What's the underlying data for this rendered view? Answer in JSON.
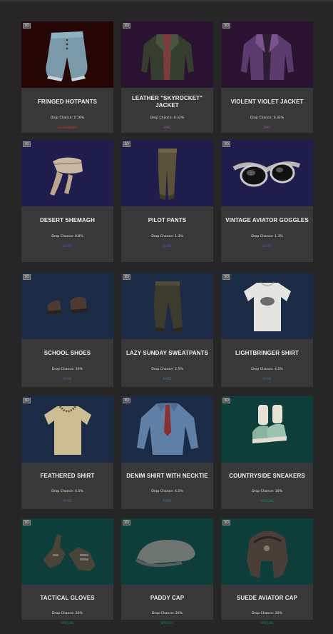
{
  "drop_chance_label": "Drop Chance:",
  "badge": "3D",
  "colors": {
    "legendary": "#c0392b",
    "epic": "#9b59b6",
    "elite": "#5b5bd6",
    "rare": "#4d6f9a",
    "special": "#1f8a6a"
  },
  "items": [
    {
      "name": "FRINGED HOTPANTS",
      "drop": "0.16%",
      "rarity": "LEGENDARY",
      "icon": "hotpants-icon"
    },
    {
      "name": "LEATHER \"SKYROCKET\" JACKET",
      "drop": "0.32%",
      "rarity": "EPIC",
      "icon": "leather-jacket-icon"
    },
    {
      "name": "VIOLENT VIOLET JACKET",
      "drop": "0.32%",
      "rarity": "EPIC",
      "icon": "violet-jacket-icon"
    },
    {
      "name": "DESERT SHEMAGH",
      "drop": "0.8%",
      "rarity": "ELITE",
      "icon": "shemagh-icon"
    },
    {
      "name": "PILOT PANTS",
      "drop": "1.3%",
      "rarity": "ELITE",
      "icon": "pilot-pants-icon"
    },
    {
      "name": "VINTAGE AVIATOR GOGGLES",
      "drop": "1.3%",
      "rarity": "ELITE",
      "icon": "goggles-icon"
    },
    {
      "name": "SCHOOL SHOES",
      "drop": "10%",
      "rarity": "RARE",
      "icon": "shoes-icon"
    },
    {
      "name": "LAZY SUNDAY SWEATPANTS",
      "drop": "2.5%",
      "rarity": "RARE",
      "icon": "sweatpants-icon"
    },
    {
      "name": "LIGHTBRINGER SHIRT",
      "drop": "4.5%",
      "rarity": "RARE",
      "icon": "tshirt-icon"
    },
    {
      "name": "FEATHERED SHIRT",
      "drop": "4.5%",
      "rarity": "RARE",
      "icon": "feathered-shirt-icon"
    },
    {
      "name": "DENIM SHIRT WITH NECKTIE",
      "drop": "4.5%",
      "rarity": "RARE",
      "icon": "denim-shirt-icon"
    },
    {
      "name": "COUNTRYSIDE SNEAKERS",
      "drop": "10%",
      "rarity": "SPECIAL",
      "icon": "sneakers-icon"
    },
    {
      "name": "TACTICAL GLOVES",
      "drop": "20%",
      "rarity": "SPECIAL",
      "icon": "gloves-icon"
    },
    {
      "name": "PADDY CAP",
      "drop": "20%",
      "rarity": "SPECIAL",
      "icon": "paddy-cap-icon"
    },
    {
      "name": "SUEDE AVIATOR CAP",
      "drop": "20%",
      "rarity": "SPECIAL",
      "icon": "aviator-cap-icon"
    }
  ]
}
